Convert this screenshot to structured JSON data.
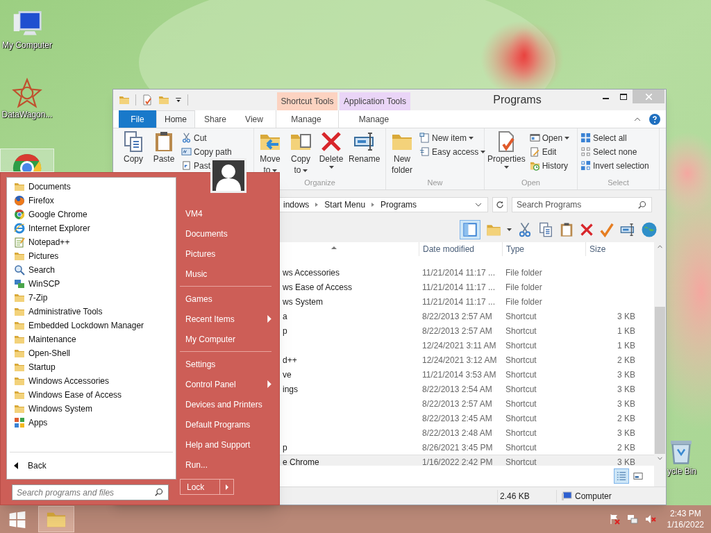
{
  "desktop_icons": [
    {
      "label": "My Computer",
      "kind": "computer",
      "selected": false
    },
    {
      "label": "DataWagon...",
      "kind": "star",
      "selected": false
    },
    {
      "kind": "chrome",
      "selected": true
    }
  ],
  "recycle_bin": {
    "label": "ycle Bin"
  },
  "explorer": {
    "title": "Programs",
    "context_tabs": [
      {
        "label": "Shortcut Tools",
        "color": "#fcd3c1"
      },
      {
        "label": "Application Tools",
        "color": "#ead5f7"
      }
    ],
    "tabs": [
      {
        "label": "File",
        "kind": "file",
        "selected": false
      },
      {
        "label": "Home",
        "kind": "tab",
        "selected": true
      },
      {
        "label": "Share",
        "kind": "tab",
        "selected": false
      },
      {
        "label": "View",
        "kind": "tab",
        "selected": false
      },
      {
        "label": "Manage",
        "kind": "context",
        "selected": false
      },
      {
        "label": "Manage",
        "kind": "context",
        "selected": false
      }
    ],
    "ribbon": [
      {
        "large": [
          {
            "lines": [
              "Copy"
            ],
            "kind": "copy",
            "dropdown": false
          },
          {
            "lines": [
              "Paste"
            ],
            "kind": "paste",
            "dropdown": false
          }
        ],
        "small": [
          {
            "label": "Cut",
            "kind": "cut",
            "dropdown": false
          },
          {
            "label": "Copy path",
            "kind": "path",
            "dropdown": false
          },
          {
            "label": "Past",
            "kind": "shortcut",
            "dropdown": false
          }
        ]
      },
      {
        "label": "Organize",
        "large": [
          {
            "lines": [
              "Move",
              "to"
            ],
            "kind": "move",
            "dropdown": true
          },
          {
            "lines": [
              "Copy",
              "to"
            ],
            "kind": "copyto",
            "dropdown": true
          },
          {
            "lines": [
              "Delete"
            ],
            "kind": "delete",
            "dropdown": true
          },
          {
            "lines": [
              "Rename"
            ],
            "kind": "rename",
            "dropdown": false
          }
        ]
      },
      {
        "label": "New",
        "large": [
          {
            "lines": [
              "New",
              "folder"
            ],
            "kind": "newfolder",
            "dropdown": false
          }
        ],
        "small": [
          {
            "label": "New item",
            "kind": "newitem",
            "dropdown": true
          },
          {
            "label": "Easy access",
            "kind": "easy",
            "dropdown": true
          }
        ]
      },
      {
        "label": "Open",
        "large": [
          {
            "lines": [
              "Properties"
            ],
            "kind": "properties",
            "dropdown": true
          }
        ],
        "small": [
          {
            "label": "Open",
            "kind": "open",
            "dropdown": true
          },
          {
            "label": "Edit",
            "kind": "edit",
            "dropdown": false
          },
          {
            "label": "History",
            "kind": "history",
            "dropdown": false
          }
        ]
      },
      {
        "label": "Select",
        "small": [
          {
            "label": "Select all",
            "kind": "selectall",
            "dropdown": false
          },
          {
            "label": "Select none",
            "kind": "selectnone",
            "dropdown": false
          },
          {
            "label": "Invert selection",
            "kind": "invert",
            "dropdown": false
          }
        ]
      }
    ],
    "address": [
      "indows",
      "Start Menu",
      "Programs"
    ],
    "search_placeholder": "Search Programs",
    "columns": [
      "Date modified",
      "Type",
      "Size"
    ],
    "rows": [
      {
        "name": "ws Accessories",
        "date": "11/21/2014 11:17 ...",
        "type": "File folder",
        "selected": false
      },
      {
        "name": "ws Ease of Access",
        "date": "11/21/2014 11:17 ...",
        "type": "File folder",
        "selected": false
      },
      {
        "name": "ws System",
        "date": "11/21/2014 11:17 ...",
        "type": "File folder",
        "selected": false
      },
      {
        "name": "a",
        "date": "8/22/2013 2:57 AM",
        "type": "Shortcut",
        "size": "3 KB",
        "selected": false
      },
      {
        "name": "p",
        "date": "8/22/2013 2:57 AM",
        "type": "Shortcut",
        "size": "1 KB",
        "selected": false
      },
      {
        "date": "12/24/2021 3:11 AM",
        "type": "Shortcut",
        "size": "1 KB",
        "selected": false
      },
      {
        "name": "d++",
        "date": "12/24/2021 3:12 AM",
        "type": "Shortcut",
        "size": "2 KB",
        "selected": false
      },
      {
        "name": "ve",
        "date": "11/21/2014 3:53 AM",
        "type": "Shortcut",
        "size": "3 KB",
        "selected": false
      },
      {
        "name": "ings",
        "date": "8/22/2013 2:54 AM",
        "type": "Shortcut",
        "size": "3 KB",
        "selected": false
      },
      {
        "date": "8/22/2013 2:57 AM",
        "type": "Shortcut",
        "size": "3 KB",
        "selected": false
      },
      {
        "date": "8/22/2013 2:45 AM",
        "type": "Shortcut",
        "size": "2 KB",
        "selected": false
      },
      {
        "date": "8/22/2013 2:48 AM",
        "type": "Shortcut",
        "size": "3 KB",
        "selected": false
      },
      {
        "name": "p",
        "date": "8/26/2021 3:45 PM",
        "type": "Shortcut",
        "size": "2 KB",
        "selected": false
      },
      {
        "name": "e Chrome",
        "date": "1/16/2022 2:42 PM",
        "type": "Shortcut",
        "size": "3 KB",
        "selected": true
      }
    ],
    "status": {
      "size": "2.46 KB",
      "location": "Computer"
    }
  },
  "start_menu": {
    "programs": [
      {
        "label": "Documents",
        "kind": "folder"
      },
      {
        "label": "Firefox",
        "kind": "firefox"
      },
      {
        "label": "Google Chrome",
        "kind": "chrome"
      },
      {
        "label": "Internet Explorer",
        "kind": "ie"
      },
      {
        "label": "Notepad++",
        "kind": "notepad"
      },
      {
        "label": "Pictures",
        "kind": "folder"
      },
      {
        "label": "Search",
        "kind": "search"
      },
      {
        "label": "WinSCP",
        "kind": "winscp"
      },
      {
        "label": "7-Zip",
        "kind": "folder"
      },
      {
        "label": "Administrative Tools",
        "kind": "folder"
      },
      {
        "label": "Embedded Lockdown Manager",
        "kind": "folder"
      },
      {
        "label": "Maintenance",
        "kind": "folder"
      },
      {
        "label": "Open-Shell",
        "kind": "folder"
      },
      {
        "label": "Startup",
        "kind": "folder"
      },
      {
        "label": "Windows Accessories",
        "kind": "folder"
      },
      {
        "label": "Windows Ease of Access",
        "kind": "folder"
      },
      {
        "label": "Windows System",
        "kind": "folder"
      },
      {
        "label": "Apps",
        "kind": "apps"
      }
    ],
    "back": "Back",
    "search_placeholder": "Search programs and files",
    "places": [
      [
        {
          "label": "VM4",
          "submenu": false
        },
        {
          "label": "Documents",
          "submenu": false
        },
        {
          "label": "Pictures",
          "submenu": false
        },
        {
          "label": "Music",
          "submenu": false
        }
      ],
      [
        {
          "label": "Games",
          "submenu": false
        },
        {
          "label": "Recent Items",
          "submenu": true
        },
        {
          "label": "My Computer",
          "submenu": false
        }
      ],
      [
        {
          "label": "Settings",
          "submenu": false
        },
        {
          "label": "Control Panel",
          "submenu": true
        },
        {
          "label": "Devices and Printers",
          "submenu": false
        },
        {
          "label": "Default Programs",
          "submenu": false
        },
        {
          "label": "Help and Support",
          "submenu": false
        },
        {
          "label": "Run...",
          "submenu": false
        }
      ]
    ],
    "lock": "Lock"
  },
  "taskbar": {
    "time": "2:43 PM",
    "date": "1/16/2022"
  }
}
